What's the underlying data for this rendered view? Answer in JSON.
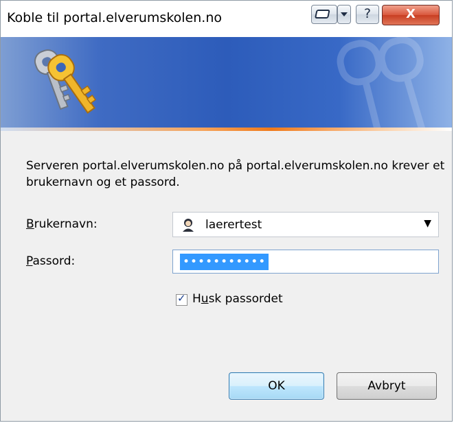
{
  "window": {
    "title": "Koble til portal.elverumskolen.no"
  },
  "title_buttons": {
    "help": "?",
    "close": "X"
  },
  "message": "Serveren portal.elverumskolen.no på portal.elverumskolen.no krever et brukernavn og et passord.",
  "username": {
    "label_accel": "B",
    "label_rest": "rukernavn:",
    "value": "laerertest"
  },
  "password": {
    "label_accel": "P",
    "label_rest": "assord:",
    "value": "•••••••••••"
  },
  "remember": {
    "checked": true,
    "label_pre": "H",
    "label_accel": "u",
    "label_rest": "sk passordet"
  },
  "buttons": {
    "ok": "OK",
    "cancel": "Avbryt"
  },
  "colors": {
    "banner": "#2d5cba",
    "accent_line": "#f07a1b",
    "selection": "#3399ff"
  }
}
